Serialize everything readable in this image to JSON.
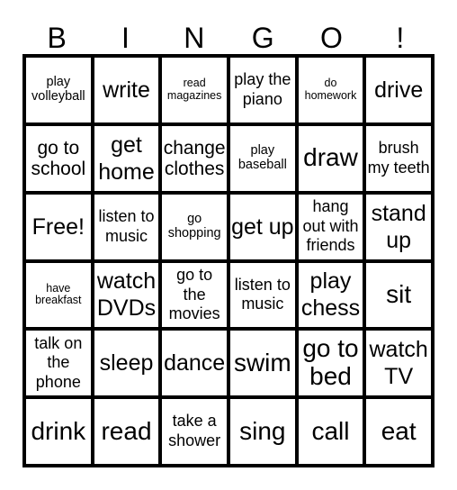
{
  "header": [
    "B",
    "I",
    "N",
    "G",
    "O",
    "!"
  ],
  "cells": [
    [
      "play volleyball",
      "write",
      "read magazines",
      "play the piano",
      "do homework",
      "drive"
    ],
    [
      "go to school",
      "get home",
      "change clothes",
      "play baseball",
      "draw",
      "brush my teeth"
    ],
    [
      "Free!",
      "listen to music",
      "go shopping",
      "get up",
      "hang out with friends",
      "stand up"
    ],
    [
      "have breakfast",
      "watch DVDs",
      "go to the movies",
      "listen to music",
      "play chess",
      "sit"
    ],
    [
      "talk on the phone",
      "sleep",
      "dance",
      "swim",
      "go to bed",
      "watch TV"
    ],
    [
      "drink",
      "read",
      "take a shower",
      "sing",
      "call",
      "eat"
    ]
  ]
}
